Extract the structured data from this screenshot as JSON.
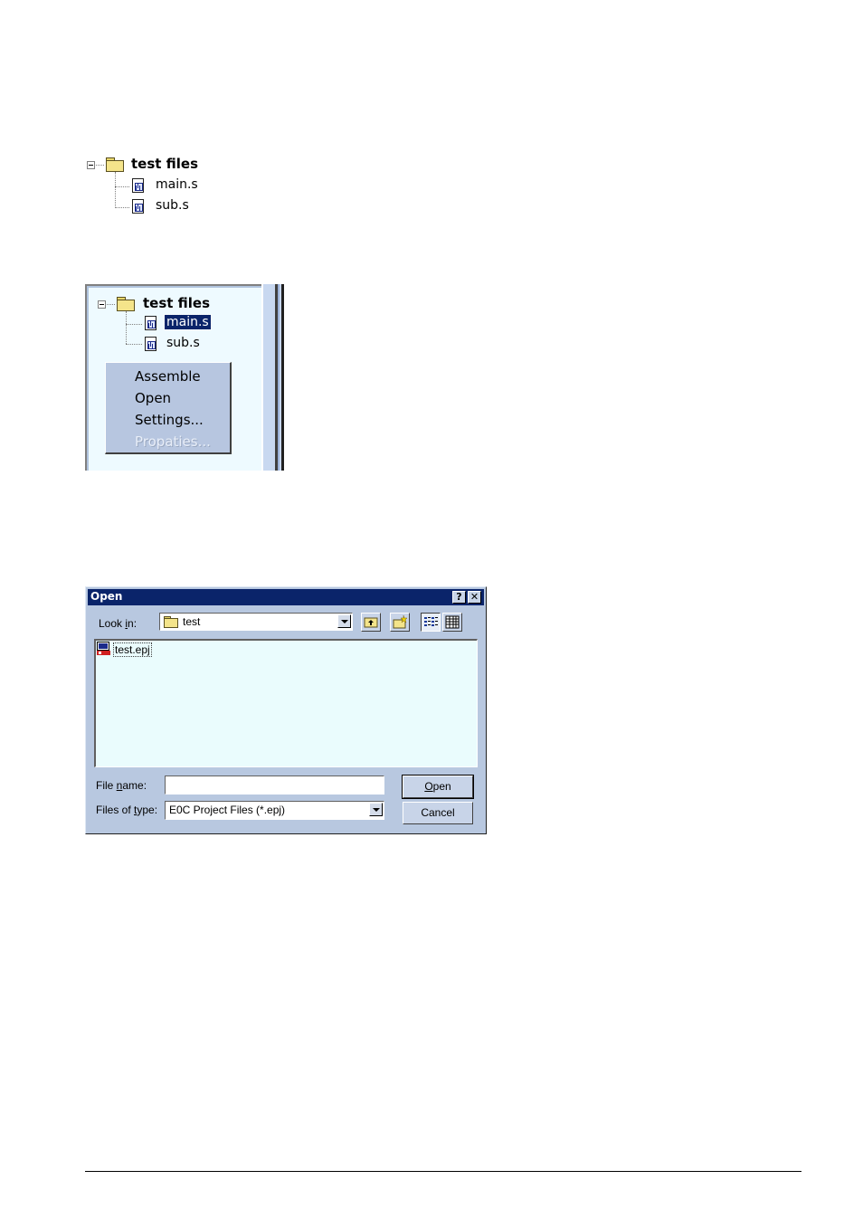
{
  "tree_figure": {
    "folder_label": "test files",
    "files": [
      "main.s",
      "sub.s"
    ]
  },
  "context_figure": {
    "folder_label": "test files",
    "selected_file": "main.s",
    "other_file": "sub.s",
    "menu": {
      "items": [
        {
          "label": "Assemble",
          "enabled": true
        },
        {
          "label": "Open",
          "enabled": true
        },
        {
          "label": "Settings...",
          "enabled": true
        },
        {
          "label": "Propaties...",
          "enabled": false
        }
      ]
    }
  },
  "open_dialog": {
    "title": "Open",
    "help_button": "?",
    "close_button": "✕",
    "look_in": {
      "label_pre": "Look ",
      "label_key": "i",
      "label_post": "n:",
      "value": "test"
    },
    "toolbar_icons": [
      "up-one-level-icon",
      "create-new-folder-icon",
      "list-view-icon",
      "details-view-icon"
    ],
    "files": [
      {
        "name": "test.epj",
        "icon": "epj-project-icon"
      }
    ],
    "file_name": {
      "label_pre": "File ",
      "label_key": "n",
      "label_post": "ame:",
      "value": ""
    },
    "files_of_type": {
      "label_pre": "Files of ",
      "label_key": "t",
      "label_post": "ype:",
      "value": "E0C Project Files (*.epj)"
    },
    "buttons": {
      "open": {
        "key": "O",
        "rest": "pen"
      },
      "cancel": "Cancel"
    }
  }
}
